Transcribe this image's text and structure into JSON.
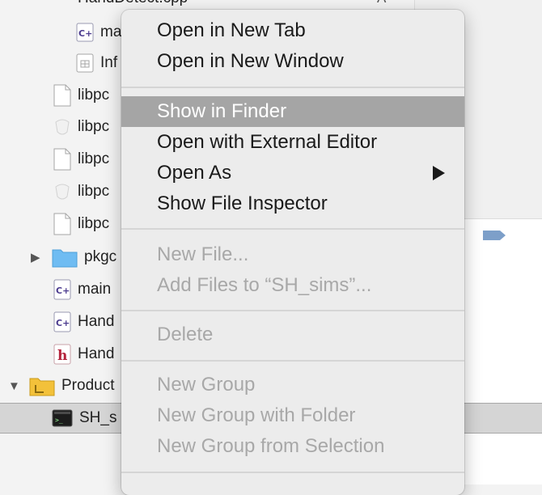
{
  "navigator": {
    "cut_top_item": {
      "label": "HandDetect.cpp",
      "status": "A"
    },
    "items": [
      {
        "label": "ma",
        "icon": "cpp-file-icon"
      },
      {
        "label": "Inf",
        "icon": "plist-file-icon"
      },
      {
        "label": "libpc",
        "icon": "document-icon"
      },
      {
        "label": "libpc",
        "icon": "dylib-icon"
      },
      {
        "label": "libpc",
        "icon": "document-icon"
      },
      {
        "label": "libpc",
        "icon": "dylib-icon"
      },
      {
        "label": "libpc",
        "icon": "document-icon"
      },
      {
        "label": "pkgc",
        "icon": "folder-icon"
      },
      {
        "label": "main",
        "icon": "cpp-file-icon"
      },
      {
        "label": "Hand",
        "icon": "cpp-file-icon"
      },
      {
        "label": "Hand",
        "icon": "header-file-icon"
      },
      {
        "label": "Product",
        "icon": "folder-icon"
      },
      {
        "label": "SH_s",
        "icon": "terminal-executable-icon"
      }
    ]
  },
  "context_menu": {
    "groups": [
      [
        {
          "label": "Open in New Tab",
          "enabled": true
        },
        {
          "label": "Open in New Window",
          "enabled": true
        }
      ],
      [
        {
          "label": "Show in Finder",
          "enabled": true,
          "highlighted": true
        },
        {
          "label": "Open with External Editor",
          "enabled": true
        },
        {
          "label": "Open As",
          "enabled": true,
          "submenu": true
        },
        {
          "label": "Show File Inspector",
          "enabled": true
        }
      ],
      [
        {
          "label": "New File...",
          "enabled": false
        },
        {
          "label": "Add Files to “SH_sims”...",
          "enabled": false
        }
      ],
      [
        {
          "label": "Delete",
          "enabled": false
        }
      ],
      [
        {
          "label": "New Group",
          "enabled": false
        },
        {
          "label": "New Group with Folder",
          "enabled": false
        },
        {
          "label": "New Group from Selection",
          "enabled": false
        }
      ]
    ]
  },
  "colors": {
    "menu_background": "#ececec",
    "menu_highlight": "#a5a5a5",
    "disabled_text": "#a8a8a8",
    "folder_blue": "#6fbcf2",
    "folder_yellow": "#f3c13a",
    "header_red": "#b3213a",
    "cpp_purple": "#4b3b8f"
  }
}
